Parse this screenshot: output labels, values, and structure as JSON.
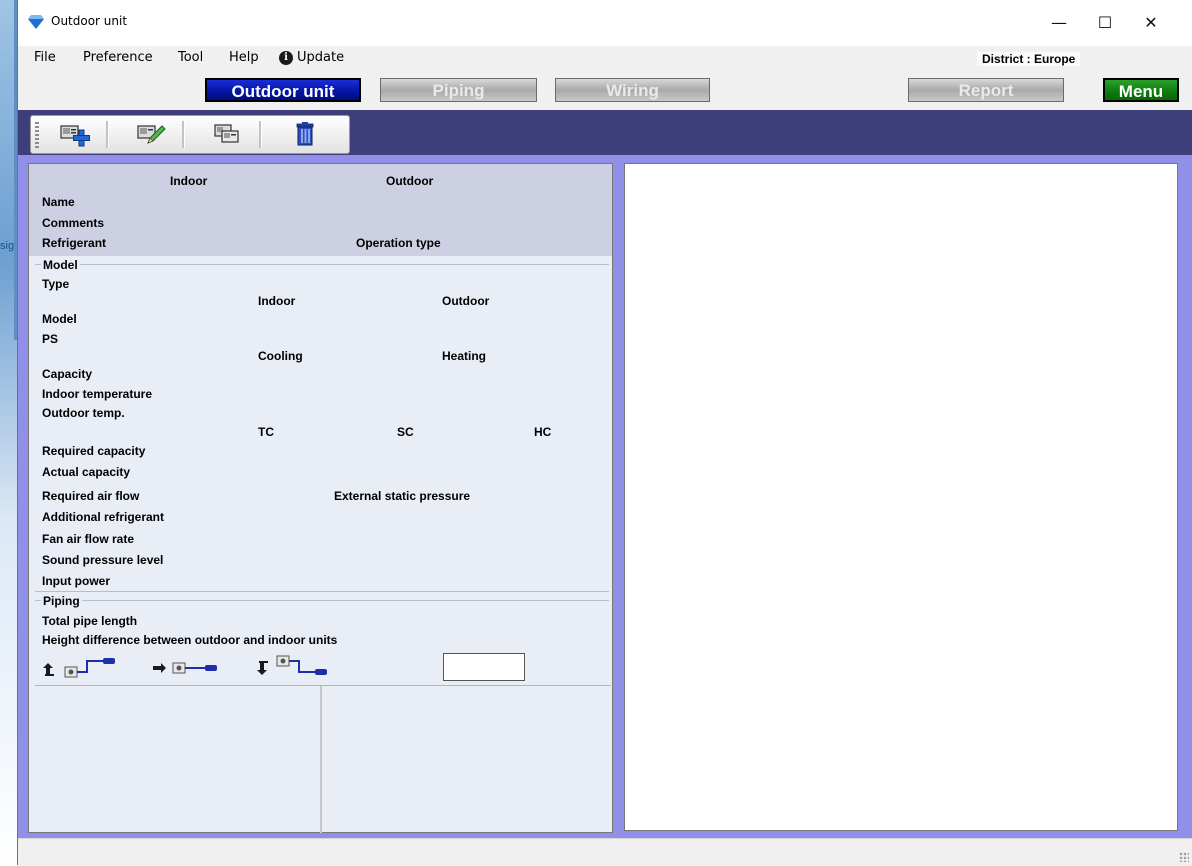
{
  "background": {
    "partial_text": "sig"
  },
  "window": {
    "title": "Outdoor unit",
    "controls": {
      "minimize": "—",
      "maximize": "☐",
      "close": "✕"
    }
  },
  "menu": {
    "file": "File",
    "preference": "Preference",
    "tool": "Tool",
    "help": "Help",
    "update": "Update",
    "update_icon": "info-icon",
    "district": "District : Europe"
  },
  "tabs": {
    "outdoor_unit": "Outdoor unit",
    "piping": "Piping",
    "wiring": "Wiring",
    "report": "Report",
    "menu": "Menu"
  },
  "toolbar": {
    "buttons": [
      {
        "name": "add-unit",
        "icon": "add-unit-icon"
      },
      {
        "name": "edit-unit",
        "icon": "edit-unit-icon"
      },
      {
        "name": "copy-unit",
        "icon": "copy-unit-icon"
      },
      {
        "name": "delete-unit",
        "icon": "trash-icon"
      }
    ]
  },
  "panel": {
    "header": {
      "indoor": "Indoor",
      "outdoor": "Outdoor",
      "name": "Name",
      "comments": "Comments",
      "refrigerant": "Refrigerant",
      "operation_type": "Operation type"
    },
    "model": {
      "group": "Model",
      "type": "Type",
      "indoor": "Indoor",
      "outdoor": "Outdoor",
      "model": "Model",
      "ps": "PS",
      "cooling": "Cooling",
      "heating": "Heating",
      "capacity": "Capacity",
      "indoor_temperature": "Indoor temperature",
      "outdoor_temp": "Outdoor temp.",
      "tc": "TC",
      "sc": "SC",
      "hc": "HC",
      "required_capacity": "Required capacity",
      "actual_capacity": "Actual capacity",
      "required_air_flow": "Required air flow",
      "external_static_pressure": "External static pressure",
      "additional_refrigerant": "Additional refrigerant",
      "fan_air_flow_rate": "Fan air flow rate",
      "sound_pressure_level": "Sound pressure level",
      "input_power": "Input power"
    },
    "piping": {
      "group": "Piping",
      "total_pipe_length": "Total pipe length",
      "height_difference": "Height difference between outdoor and indoor units",
      "layouts": [
        "outdoor-above-icon",
        "same-level-icon",
        "outdoor-below-icon"
      ]
    }
  },
  "colors": {
    "active_tab": "#0415a8",
    "menu_tab": "#0d7a0d",
    "toolbar_band": "#3e3e7a",
    "main_frame": "#9090e8",
    "panel_header": "#cdd0e2",
    "panel_body": "#e8edf6"
  }
}
